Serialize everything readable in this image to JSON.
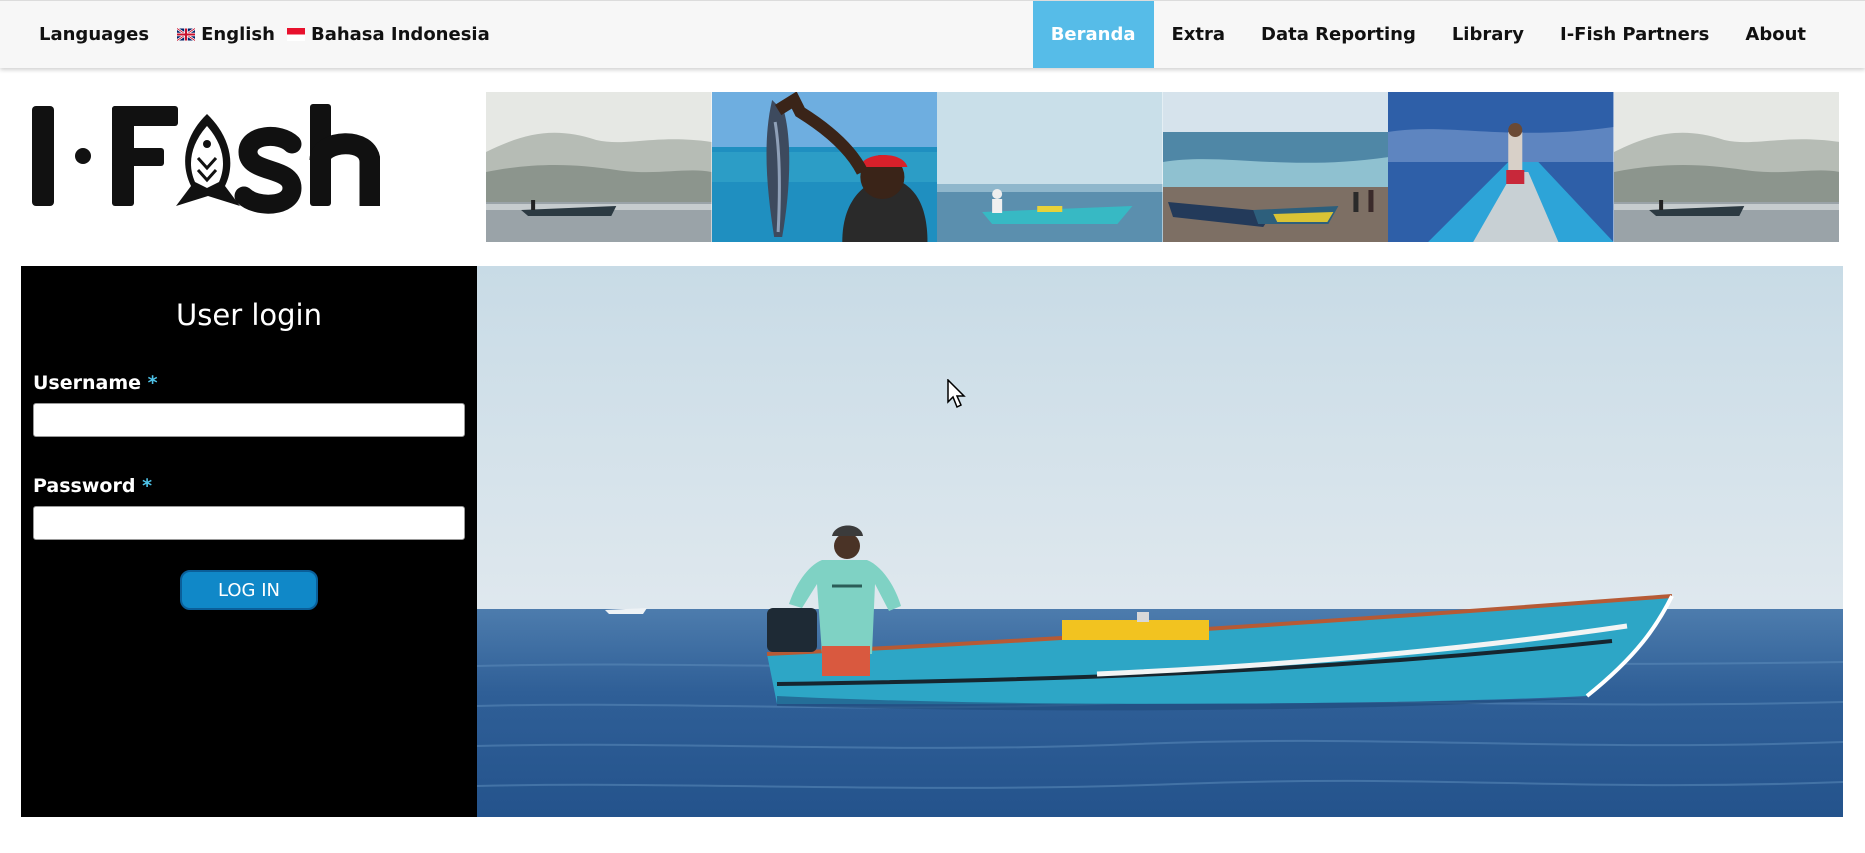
{
  "topbar": {
    "languages_label": "Languages",
    "languages": [
      {
        "label": "English",
        "flag_icon": "uk-flag-icon"
      },
      {
        "label": "Bahasa Indonesia",
        "flag_icon": "indonesia-flag-icon"
      }
    ],
    "nav": [
      {
        "label": "Beranda",
        "active": true
      },
      {
        "label": "Extra"
      },
      {
        "label": "Data Reporting"
      },
      {
        "label": "Library"
      },
      {
        "label": "I-Fish Partners"
      },
      {
        "label": "About"
      }
    ]
  },
  "header": {
    "logo_text": "I-Fish",
    "strip_photos": [
      "foggy-sea-boat-photo",
      "fisher-holding-tuna-photo",
      "boat-on-calm-sea-photo",
      "boats-on-beach-photo",
      "fisher-on-boat-deck-photo",
      "foggy-sea-boat-photo"
    ]
  },
  "login": {
    "title": "User login",
    "username_label": "Username",
    "password_label": "Password",
    "required_marker": "*",
    "username_value": "",
    "password_value": "",
    "button_label": "LOG IN"
  },
  "hero": {
    "image": "fisherman-in-blue-boat-at-sea-photo"
  },
  "colors": {
    "nav_active_bg": "#56bce8",
    "login_panel_bg": "#000000",
    "login_button_bg": "#1088c8",
    "required_marker": "#4fc3e8"
  }
}
